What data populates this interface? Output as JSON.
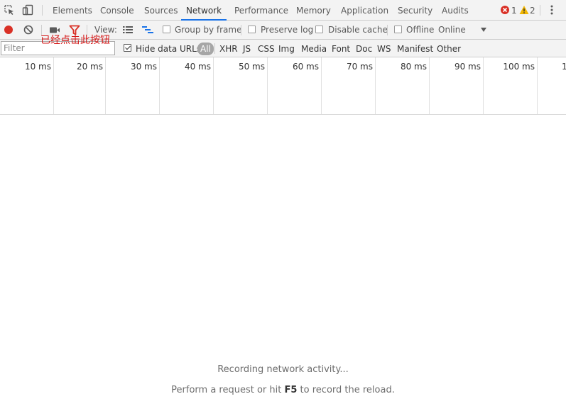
{
  "tabs": [
    {
      "label": "Elements"
    },
    {
      "label": "Console"
    },
    {
      "label": "Sources"
    },
    {
      "label": "Network"
    },
    {
      "label": "Performance"
    },
    {
      "label": "Memory"
    },
    {
      "label": "Application"
    },
    {
      "label": "Security"
    },
    {
      "label": "Audits"
    }
  ],
  "active_tab": "Network",
  "status": {
    "errors": "1",
    "warnings": "2"
  },
  "toolbar": {
    "view_label": "View:",
    "group_by_frame": "Group by frame",
    "preserve_log": "Preserve log",
    "disable_cache": "Disable cache",
    "offline": "Offline",
    "throttle": "Online"
  },
  "annotation": "已经点击此按钮",
  "filter": {
    "placeholder": "Filter",
    "hide_data_urls": "Hide data URLs",
    "types": [
      "All",
      "XHR",
      "JS",
      "CSS",
      "Img",
      "Media",
      "Font",
      "Doc",
      "WS",
      "Manifest",
      "Other"
    ]
  },
  "timeline": {
    "ticks": [
      "10 ms",
      "20 ms",
      "30 ms",
      "40 ms",
      "50 ms",
      "60 ms",
      "70 ms",
      "80 ms",
      "90 ms",
      "100 ms",
      "1"
    ]
  },
  "empty": {
    "recording": "Recording network activity...",
    "hint_pre": "Perform a request or hit ",
    "hint_key": "F5",
    "hint_post": " to record the reload."
  },
  "colors": {
    "record": "#d93025",
    "filter_icon": "#d93025",
    "accent": "#1a73e8",
    "annotation": "#d41a1a"
  },
  "icons": [
    "inspect-element-icon",
    "device-toolbar-icon",
    "record-icon",
    "clear-icon",
    "capture-screenshots-icon",
    "filter-icon",
    "large-rows-icon",
    "overview-icon",
    "more-options-icon",
    "error-icon",
    "warning-icon",
    "dropdown-arrow-icon"
  ]
}
